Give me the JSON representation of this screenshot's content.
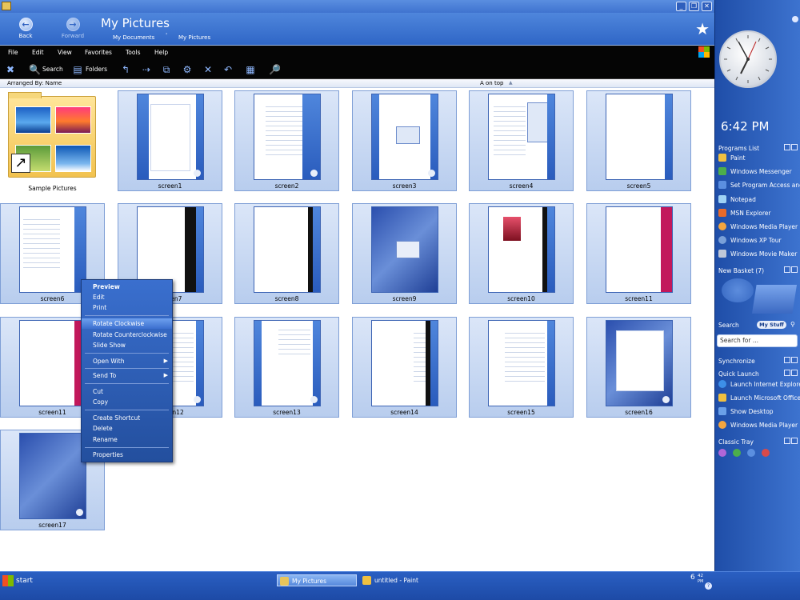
{
  "window": {
    "title_icon": "folder-icon",
    "controls": [
      "_",
      "❐",
      "✕"
    ]
  },
  "nav": {
    "back_label": "Back",
    "forward_label": "Forward",
    "folder_title": "My Pictures",
    "crumbs": [
      "My Documents",
      "My Pictures"
    ],
    "crumb_separator": "'",
    "favorites_star": "★"
  },
  "menubar": [
    "File",
    "Edit",
    "View",
    "Favorites",
    "Tools",
    "Help"
  ],
  "toolbar": {
    "search_label": "Search",
    "folders_label": "Folders"
  },
  "arrangebar": {
    "arranged_by": "Arranged By: Name",
    "sort_label": "A on top",
    "sort_arrow": "▲"
  },
  "folder_item": {
    "label": "Sample Pictures"
  },
  "thumbnails": [
    "screen1",
    "screen2",
    "screen3",
    "screen4",
    "screen5",
    "screen6",
    "screen7",
    "screen8",
    "screen9",
    "screen10",
    "screen11",
    "screen11",
    "screen12",
    "screen13",
    "screen14",
    "screen15",
    "screen16",
    "screen17"
  ],
  "context_menu": {
    "items": [
      "Preview",
      "Edit",
      "Print",
      "Rotate Clockwise",
      "Rotate Counterclockwise",
      "Slide Show",
      "Open With",
      "Send To",
      "Cut",
      "Copy",
      "Create Shortcut",
      "Delete",
      "Rename",
      "Properties"
    ],
    "submenu_arrow": "▶"
  },
  "sidebar": {
    "time": "6:42 PM",
    "programs_list": {
      "header": "Programs List",
      "items": [
        "Paint",
        "Windows Messenger",
        "Set Program Access and Defaults",
        "Notepad",
        "MSN Explorer",
        "Windows Media Player",
        "Windows XP Tour",
        "Windows Movie Maker"
      ]
    },
    "basket_header": "New Basket (7)",
    "search_header": "Search",
    "mystuff_label": "My Stuff",
    "search_placeholder": "Search for ...",
    "synchronize_header": "Synchronize",
    "quick_launch": {
      "header": "Quick Launch",
      "items": [
        "Launch Internet Explorer Browser",
        "Launch Microsoft Office Outlook",
        "Show Desktop",
        "Windows Media Player"
      ]
    },
    "classic_tray_header": "Classic Tray"
  },
  "taskbar": {
    "start_label": "start",
    "tasks": [
      "My Pictures",
      "untitled - Paint"
    ],
    "clock_hour": "6",
    "clock_minutes": "42",
    "clock_ampm": "PM",
    "help_glyph": "?"
  }
}
